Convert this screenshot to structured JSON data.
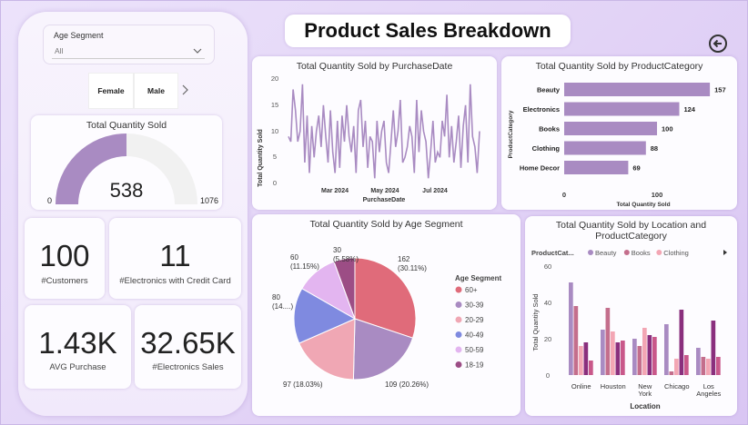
{
  "title": "Product Sales Breakdown",
  "colors": {
    "purple": "#a98bc2",
    "pie": [
      "#e06b7a",
      "#a98bc2",
      "#f0a7b4",
      "#7f8ae0",
      "#e3b5f0",
      "#9c4d85"
    ]
  },
  "filter": {
    "label": "Age Segment",
    "value": "All"
  },
  "gender": {
    "female": "Female",
    "male": "Male"
  },
  "gauge": {
    "title": "Total Quantity Sold",
    "value": "538",
    "min": "0",
    "max": "1076",
    "val": 538,
    "maxv": 1076
  },
  "kpis": [
    {
      "value": "100",
      "label": "#Customers"
    },
    {
      "value": "11",
      "label": "#Electronics with Credit Card"
    },
    {
      "value": "1.43K",
      "label": "AVG Purchase"
    },
    {
      "value": "32.65K",
      "label": "#Electronics Sales"
    }
  ],
  "line": {
    "title": "Total Quantity Sold by PurchaseDate",
    "ylabel": "Total Quantity Sold",
    "xlabel": "PurchaseDate",
    "yticks": [
      "0",
      "5",
      "10",
      "15",
      "20"
    ],
    "xticks": [
      "Mar 2024",
      "May 2024",
      "Jul 2024"
    ]
  },
  "bar": {
    "title": "Total Quantity Sold by ProductCategory",
    "ylabel": "ProductCategory",
    "xlabel": "Total Quantity Sold",
    "xticks": [
      "0",
      "100"
    ]
  },
  "pie": {
    "title": "Total Quantity Sold by Age Segment",
    "legend_title": "Age Segment"
  },
  "cluster": {
    "title": "Total Quantity Sold by Location and ProductCategory",
    "legend_title": "ProductCat...",
    "ylabel": "Total Quantity Sold",
    "xlabel": "Location",
    "yticks": [
      "0",
      "20",
      "40",
      "60"
    ]
  },
  "chart_data": [
    {
      "type": "line",
      "title": "Total Quantity Sold by PurchaseDate",
      "xlabel": "PurchaseDate",
      "ylabel": "Total Quantity Sold",
      "ylim": [
        0,
        20
      ],
      "values": [
        9,
        8,
        18,
        14,
        8,
        10,
        19,
        4,
        13,
        2,
        11,
        5,
        10,
        13,
        7,
        15,
        9,
        4,
        14,
        6,
        2,
        12,
        3,
        13,
        8,
        15,
        9,
        6,
        11,
        2,
        14,
        16,
        7,
        12,
        3,
        9,
        8,
        1,
        12,
        6,
        10,
        12,
        4,
        2,
        8,
        14,
        7,
        10,
        16,
        4,
        5,
        7,
        11,
        9,
        2,
        16,
        6,
        14,
        10,
        8,
        1,
        6,
        12,
        4,
        6,
        5,
        12,
        9,
        17,
        5,
        11,
        4,
        8,
        13,
        3,
        11,
        15,
        4,
        19,
        9,
        7,
        2,
        10
      ]
    },
    {
      "type": "bar",
      "title": "Total Quantity Sold by ProductCategory",
      "xlabel": "Total Quantity Sold",
      "ylabel": "ProductCategory",
      "categories": [
        "Beauty",
        "Electronics",
        "Books",
        "Clothing",
        "Home Decor"
      ],
      "values": [
        157,
        124,
        100,
        88,
        69
      ]
    },
    {
      "type": "pie",
      "title": "Total Quantity Sold by Age Segment",
      "categories": [
        "60+",
        "30-39",
        "20-29",
        "40-49",
        "50-59",
        "18-19"
      ],
      "values": [
        162,
        109,
        97,
        80,
        60,
        30
      ],
      "labels": [
        "162\n(30.11%)",
        "109 (20.26%)",
        "97 (18.03%)",
        "80\n(14....)",
        "60\n(11.15%)",
        "30\n(5.58%)"
      ]
    },
    {
      "type": "bar",
      "title": "Total Quantity Sold by Location and ProductCategory",
      "xlabel": "Location",
      "ylabel": "Total Quantity Sold",
      "ylim": [
        0,
        60
      ],
      "categories": [
        "Online",
        "Houston",
        "New York",
        "Chicago",
        "Los Angeles"
      ],
      "series": [
        {
          "name": "Beauty",
          "color": "#a98bc2",
          "values": [
            51,
            25,
            20,
            28,
            15
          ]
        },
        {
          "name": "Books",
          "color": "#c46e8c",
          "values": [
            38,
            37,
            16,
            2,
            10
          ]
        },
        {
          "name": "Clothing",
          "color": "#f3a6b4",
          "values": [
            16,
            24,
            26,
            9,
            9
          ]
        },
        {
          "name": "",
          "color": "#8a2f7d",
          "values": [
            18,
            18,
            22,
            36,
            30
          ]
        },
        {
          "name": "",
          "color": "#c9588a",
          "values": [
            8,
            19,
            21,
            11,
            10
          ]
        }
      ]
    }
  ]
}
